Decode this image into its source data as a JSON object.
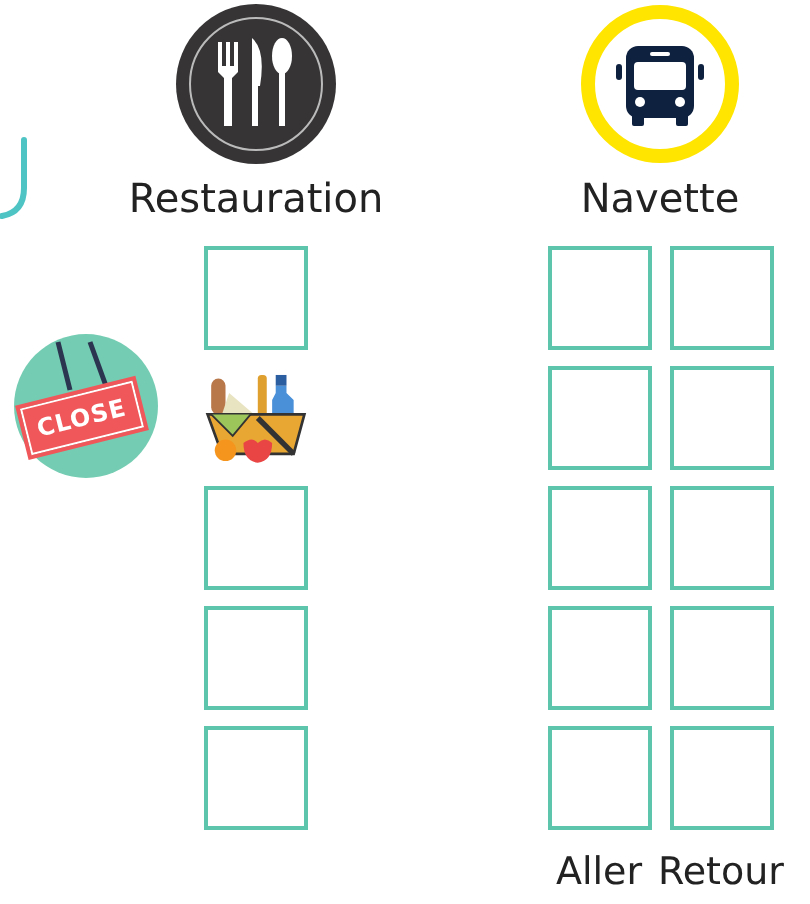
{
  "close_sign": {
    "label": "CLOSE"
  },
  "sections": [
    {
      "kind": "restaurant",
      "title": "Restauration",
      "slots": [
        {
          "kind": "empty"
        },
        {
          "kind": "basket"
        },
        {
          "kind": "empty"
        },
        {
          "kind": "empty"
        },
        {
          "kind": "empty"
        }
      ]
    },
    {
      "kind": "shuttle",
      "title": "Navette",
      "columns": [
        {
          "label": "Aller",
          "slots": [
            {
              "kind": "empty"
            },
            {
              "kind": "empty"
            },
            {
              "kind": "empty"
            },
            {
              "kind": "empty"
            },
            {
              "kind": "empty"
            }
          ]
        },
        {
          "label": "Retour",
          "slots": [
            {
              "kind": "empty"
            },
            {
              "kind": "empty"
            },
            {
              "kind": "empty"
            },
            {
              "kind": "empty"
            },
            {
              "kind": "empty"
            }
          ]
        }
      ]
    }
  ]
}
